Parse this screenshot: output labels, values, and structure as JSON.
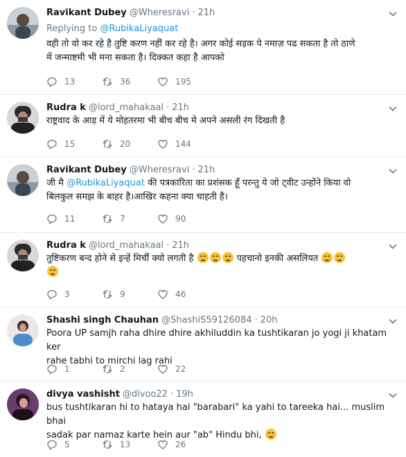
{
  "tweets": [
    {
      "name": "Ravikant Dubey",
      "handle": "@Wheresravi",
      "time": "21h",
      "reply_prefix": "Replying to ",
      "reply_mention": "@RubikaLiyaquat",
      "line1": "वही तो वो कर रहे है तुष्टि करण नहीं कर रहे है। अगर कोई सड़क पे नमाज़ पढ सकता है तो ठाणे",
      "line2": "में जन्माष्टमी भी मना सकता है। दिक्कत कहा है आपको",
      "replies": "13",
      "retweets": "36",
      "likes": "195"
    },
    {
      "name": "Rudra k",
      "handle": "@lord_mahakaal",
      "time": "21h",
      "line1": "राष्ट्रवाद के आड़ में ये मोहतरमा भी बीच बीच मे अपने असली रंग दिखती है",
      "replies": "15",
      "retweets": "20",
      "likes": "144"
    },
    {
      "name": "Ravikant Dubey",
      "handle": "@Wheresravi",
      "time": "21h",
      "pre": "जी मै ",
      "mention": "@RubikaLiyaquat",
      "post": " की पत्रकारिता का प्रशंसक हूँ परन्तु ये जो ट्वीट उन्होंने किया वो",
      "line2": "बिलकुल समझ के बाहर है।आखिर कहना क्या चाहती है।",
      "replies": "11",
      "retweets": "7",
      "likes": "90"
    },
    {
      "name": "Rudra k",
      "handle": "@lord_mahakaal",
      "time": "21h",
      "line1a": "तुष्टिकरण बन्द होने से इन्हें मिर्ची क्यो लगती है",
      "line1b": "पहचानो इनकी असलियत",
      "replies": "3",
      "retweets": "9",
      "likes": "46"
    },
    {
      "name": "Shashi singh Chauhan",
      "handle": "@ShashiS59126084",
      "time": "20h",
      "line1": "Poora UP samjh raha dhire dhire akhiluddin ka tushtikaran jo yogi ji khatam ker",
      "line2": "rahe tabhi to mirchi lag rahi",
      "replies": "1",
      "retweets": "2",
      "likes": "22"
    },
    {
      "name": "divya vashisht",
      "handle": "@divoo22",
      "time": "19h",
      "line1": "bus tushtikaran hi to hataya hai \"barabari\" ka yahi to tareeka hai... muslim bhai",
      "line2": "sadak par namaz karte hein aur \"ab\" Hindu bhi,",
      "replies": "5",
      "retweets": "13",
      "likes": "26"
    }
  ],
  "separator": "·",
  "colors": {
    "link": "#1b95e0",
    "muted": "#657786",
    "text": "#14171a",
    "border": "#e6ecf0"
  },
  "icons": [
    "reply-icon",
    "retweet-icon",
    "like-icon",
    "caret-down-icon"
  ]
}
